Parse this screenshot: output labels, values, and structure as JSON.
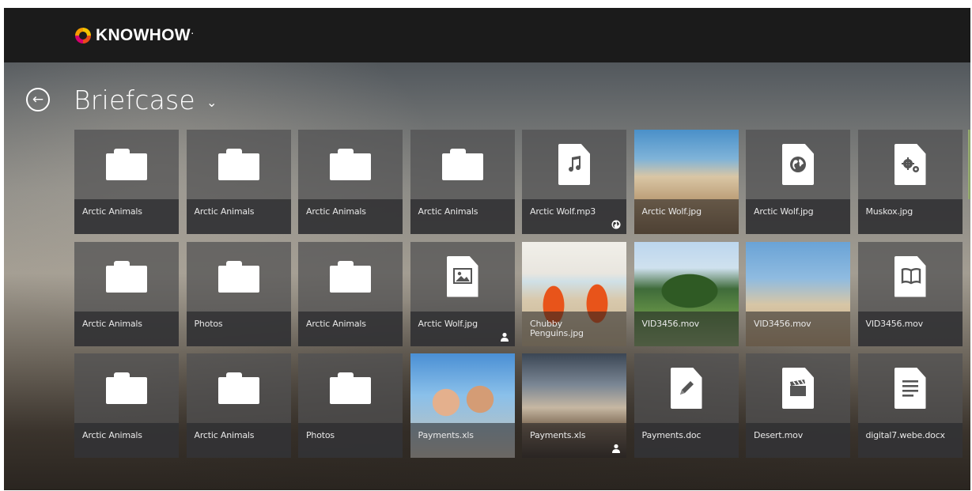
{
  "app": {
    "logo_text": "KNOWHOW",
    "logo_trademark": "."
  },
  "header": {
    "back_icon": "←",
    "title": "Briefcase",
    "dropdown_glyph": "⌄"
  },
  "tiles": [
    {
      "label": "Arctic Animals",
      "type": "folder"
    },
    {
      "label": "Arctic Animals",
      "type": "folder"
    },
    {
      "label": "Arctic Animals",
      "type": "folder"
    },
    {
      "label": "Arctic Animals",
      "type": "folder"
    },
    {
      "label": "Arctic Wolf.mp3",
      "type": "music",
      "badge": "globe"
    },
    {
      "label": "Arctic Wolf.jpg",
      "type": "photo",
      "photo": "child-beach"
    },
    {
      "label": "Arctic Wolf.jpg",
      "type": "globe"
    },
    {
      "label": "Muskox.jpg",
      "type": "gears"
    },
    {
      "label": "Arctic Animals",
      "type": "folder"
    },
    {
      "label": "Photos",
      "type": "folder"
    },
    {
      "label": "Arctic Animals",
      "type": "folder"
    },
    {
      "label": "Arctic Wolf.jpg",
      "type": "image",
      "badge": "person"
    },
    {
      "label": "Chubby Penguins.jpg",
      "type": "photo",
      "photo": "flipflops"
    },
    {
      "label": "VID3456.mov",
      "type": "photo",
      "photo": "landscape"
    },
    {
      "label": "VID3456.mov",
      "type": "photo",
      "photo": "kids-jump"
    },
    {
      "label": "VID3456.mov",
      "type": "book"
    },
    {
      "label": "Arctic Animals",
      "type": "folder"
    },
    {
      "label": "Arctic Animals",
      "type": "folder"
    },
    {
      "label": "Photos",
      "type": "folder"
    },
    {
      "label": "Payments.xls",
      "type": "photo",
      "photo": "couple"
    },
    {
      "label": "Payments.xls",
      "type": "photo",
      "photo": "sunset",
      "badge": "person"
    },
    {
      "label": "Payments.doc",
      "type": "pencil"
    },
    {
      "label": "Desert.mov",
      "type": "clapper"
    },
    {
      "label": "digital7.webe.docx",
      "type": "lines"
    }
  ]
}
